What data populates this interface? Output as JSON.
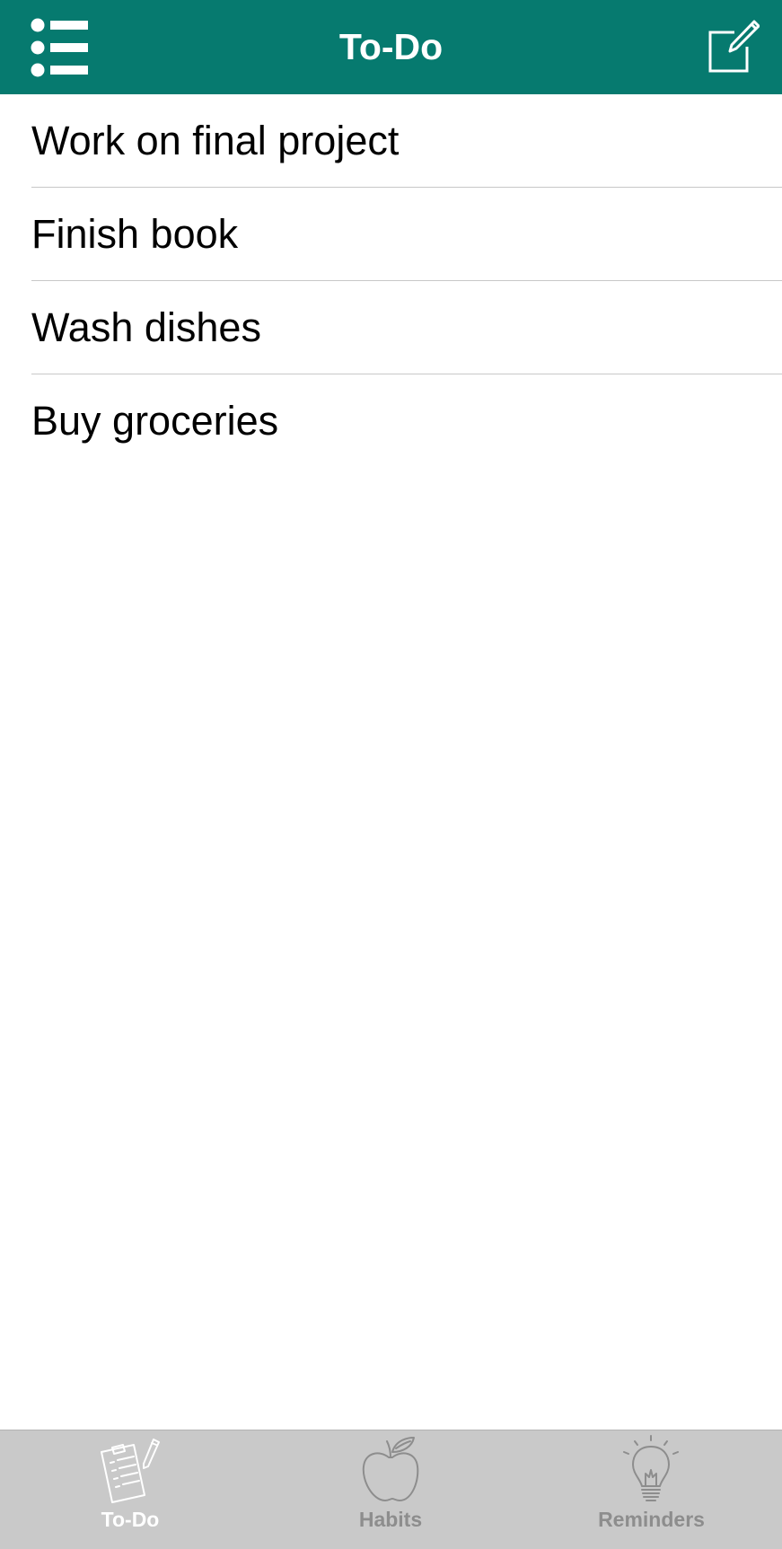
{
  "nav": {
    "title": "To-Do",
    "left_icon": "list-menu-icon",
    "right_icon": "compose-icon",
    "bar_color": "#067a6f"
  },
  "todos": [
    {
      "label": "Work on final project"
    },
    {
      "label": "Finish book"
    },
    {
      "label": "Wash dishes"
    },
    {
      "label": "Buy groceries"
    }
  ],
  "tabs": [
    {
      "label": "To-Do",
      "icon": "clipboard-icon",
      "active": true
    },
    {
      "label": "Habits",
      "icon": "apple-icon",
      "active": false
    },
    {
      "label": "Reminders",
      "icon": "lightbulb-icon",
      "active": false
    }
  ],
  "colors": {
    "tab_bar": "#c9c9c9",
    "tab_active": "#ffffff",
    "tab_inactive": "#8d8d8d"
  }
}
